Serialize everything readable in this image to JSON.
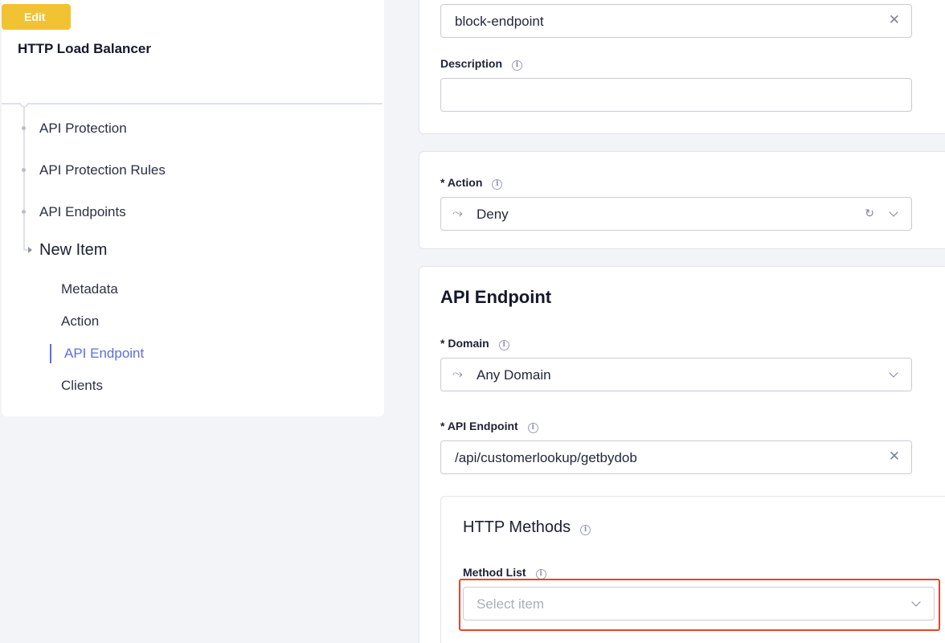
{
  "header": {
    "edit_badge": "Edit",
    "title": "HTTP Load Balancer"
  },
  "nav": {
    "items": [
      "API Protection",
      "API Protection Rules",
      "API Endpoints"
    ],
    "current": "New Item",
    "sub_items": [
      "Metadata",
      "Action",
      "API Endpoint",
      "Clients"
    ],
    "active_sub_item": "API Endpoint"
  },
  "metadata": {
    "name_value": "block-endpoint",
    "description_label": "Description",
    "description_value": ""
  },
  "action": {
    "label": "* Action",
    "value": "Deny"
  },
  "api_endpoint": {
    "section_title": "API Endpoint",
    "domain_label": "* Domain",
    "domain_value": "Any Domain",
    "endpoint_label": "* API Endpoint",
    "endpoint_value": "/api/customerlookup/getbydob"
  },
  "http_methods": {
    "title": "HTTP Methods",
    "method_list_label": "Method List",
    "method_list_placeholder": "Select item"
  },
  "icons": {
    "clear": "close-icon",
    "info": "info-icon",
    "dropdown": "chevron-down-icon",
    "refresh": "refresh-icon",
    "route": "route-icon"
  },
  "colors": {
    "edit_badge": "#f1c232",
    "active_nav": "#5b6ee1",
    "highlight": "#e4452c"
  }
}
